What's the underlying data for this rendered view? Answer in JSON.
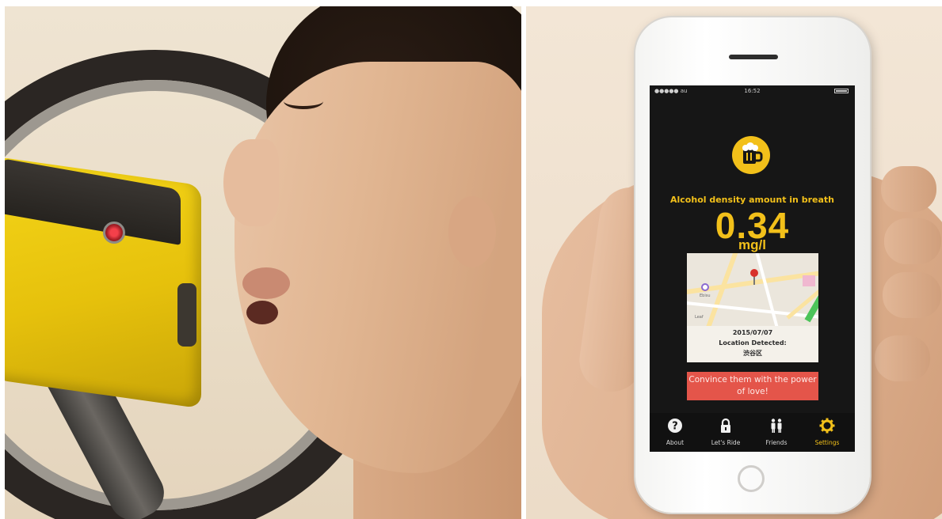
{
  "phone": {
    "status": {
      "carrier": "●●●●● au",
      "time": "16:52"
    },
    "headline": "Alcohol density amount in breath",
    "reading": {
      "value": "0.34",
      "unit": "mg/l"
    },
    "map_card": {
      "map_labels": [
        "Ebisu",
        "Leaf"
      ],
      "date": "2015/07/07",
      "location_label": "Location Detected:",
      "location_value": "渋谷区"
    },
    "action_button": "Convince them with the power of love!",
    "tabs": [
      {
        "label": "About",
        "icon": "question-circle-icon",
        "active": false
      },
      {
        "label": "Let's Ride",
        "icon": "lock-icon",
        "active": false
      },
      {
        "label": "Friends",
        "icon": "people-icon",
        "active": false
      },
      {
        "label": "Settings",
        "icon": "gear-icon",
        "active": true
      }
    ]
  },
  "colors": {
    "accent_yellow": "#f2c01a",
    "button_red": "#e4554a",
    "screen_dark": "#161616",
    "device_yellow": "#f5d619"
  }
}
